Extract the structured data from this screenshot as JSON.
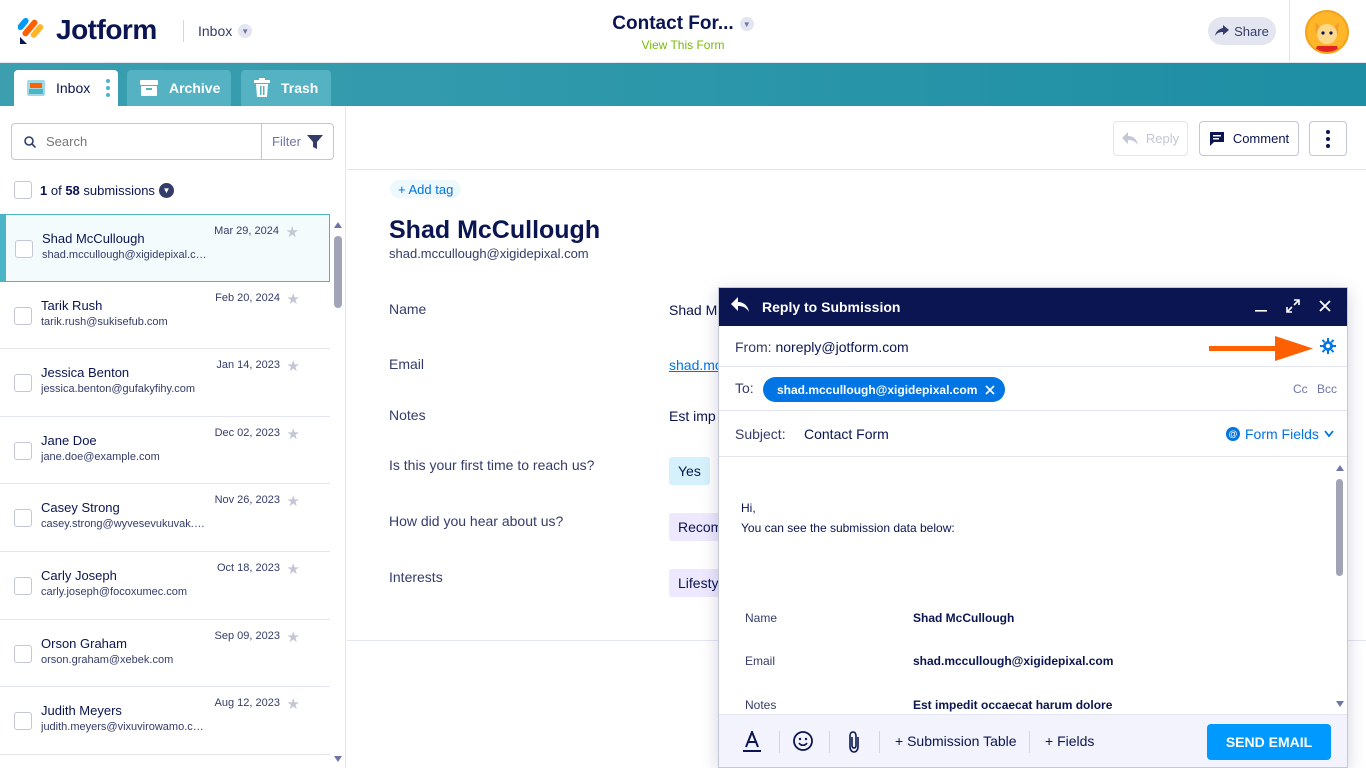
{
  "header": {
    "logo_text": "Jotform",
    "inbox_dropdown": "Inbox",
    "form_title": "Contact For...",
    "form_subtitle": "View This Form",
    "share_label": "Share"
  },
  "tabs": [
    {
      "label": "Inbox",
      "active": true
    },
    {
      "label": "Archive",
      "active": false
    },
    {
      "label": "Trash",
      "active": false
    }
  ],
  "sidebar": {
    "search_placeholder": "Search",
    "filter_label": "Filter",
    "count_current": "1",
    "count_of": " of ",
    "count_total": "58",
    "count_suffix": " submissions",
    "items": [
      {
        "name": "Shad McCullough",
        "email": "shad.mccullough@xigidepixal.com",
        "date": "Mar 29, 2024",
        "selected": true
      },
      {
        "name": "Tarik Rush",
        "email": "tarik.rush@sukisefub.com",
        "date": "Feb 20, 2024"
      },
      {
        "name": "Jessica Benton",
        "email": "jessica.benton@gufakyfihy.com",
        "date": "Jan 14, 2023"
      },
      {
        "name": "Jane Doe",
        "email": "jane.doe@example.com",
        "date": "Dec 02, 2023"
      },
      {
        "name": "Casey Strong",
        "email": "casey.strong@wyvesevukuvak.com",
        "date": "Nov 26, 2023"
      },
      {
        "name": "Carly Joseph",
        "email": "carly.joseph@focoxumec.com",
        "date": "Oct 18, 2023"
      },
      {
        "name": "Orson Graham",
        "email": "orson.graham@xebek.com",
        "date": "Sep 09, 2023"
      },
      {
        "name": "Judith Meyers",
        "email": "judith.meyers@vixuvirowamo.com",
        "date": "Aug 12, 2023"
      }
    ]
  },
  "toolbar": {
    "reply_label": "Reply",
    "comment_label": "Comment"
  },
  "submission": {
    "add_tag": "+ Add tag",
    "name": "Shad McCullough",
    "email": "shad.mccullough@xigidepixal.com",
    "fields": [
      {
        "label": "Name",
        "value": "Shad M"
      },
      {
        "label": "Email",
        "value": "shad.mc"
      },
      {
        "label": "Notes",
        "value": "Est imp"
      },
      {
        "label": "Is this your first time to reach us?",
        "value": "Yes"
      },
      {
        "label": "How did you hear about us?",
        "value": "Recom"
      },
      {
        "label": "Interests",
        "value": "Lifesty"
      }
    ]
  },
  "reply": {
    "title": "Reply to Submission",
    "from_label": "From:",
    "from_value": "noreply@jotform.com",
    "to_label": "To:",
    "to_value": "shad.mccullough@xigidepixal.com",
    "cc": "Cc",
    "bcc": "Bcc",
    "subject_label": "Subject:",
    "subject_value": "Contact Form",
    "form_fields": "Form Fields",
    "body_greeting": "Hi,",
    "body_line": "You can see the submission data below:",
    "table": [
      {
        "label": "Name",
        "value": "Shad McCullough"
      },
      {
        "label": "Email",
        "value": "shad.mccullough@xigidepixal.com"
      },
      {
        "label": "Notes",
        "value": "Est impedit occaecat harum dolore"
      }
    ],
    "submission_table": "+ Submission Table",
    "fields_btn": "+ Fields",
    "send": "SEND EMAIL"
  },
  "colors": {
    "navy": "#0a1551",
    "teal": "#1d8ea4",
    "blue": "#0075e3",
    "send": "#0099ff",
    "arrow": "#ff6100"
  }
}
